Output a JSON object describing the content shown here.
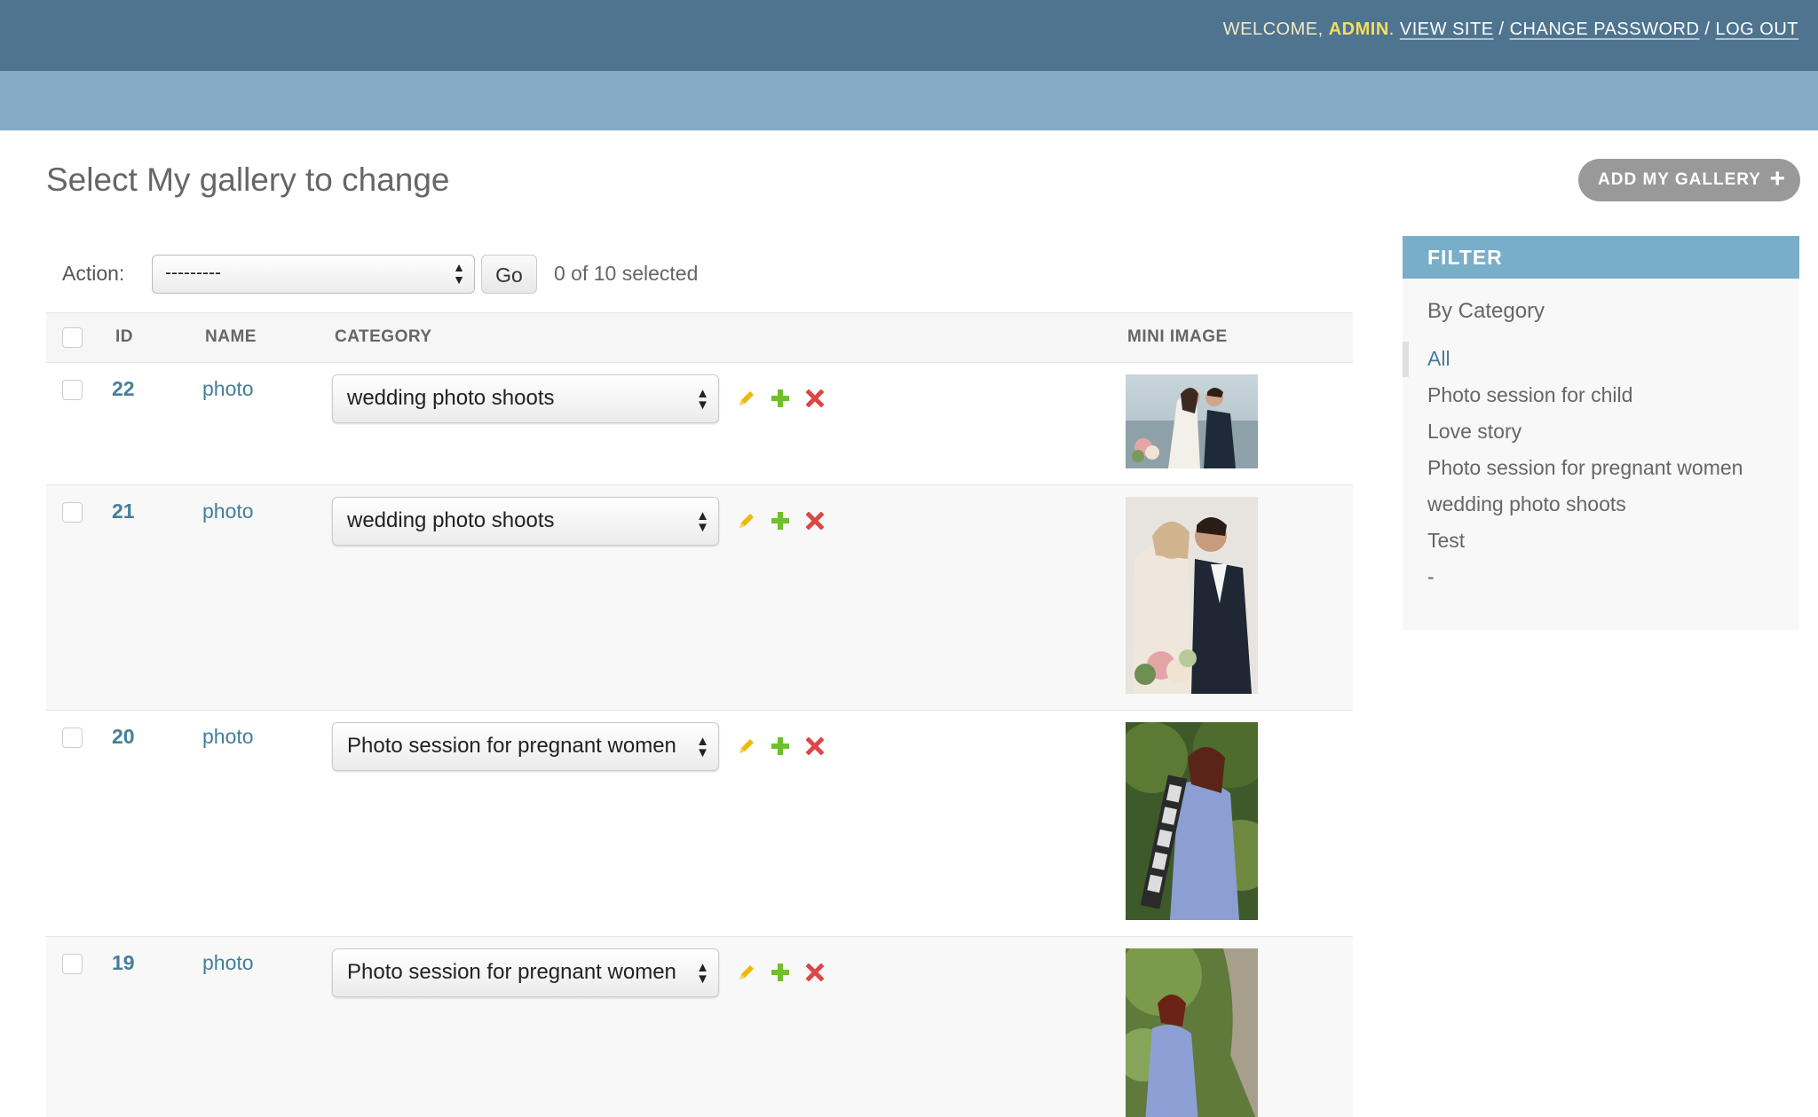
{
  "header": {
    "welcome": "WELCOME,",
    "user": "ADMIN",
    "dot": ".",
    "view_site": "VIEW SITE",
    "change_password": "CHANGE PASSWORD",
    "log_out": "LOG OUT",
    "sep": "/"
  },
  "page": {
    "title": "Select My gallery to change",
    "add_button": "ADD MY GALLERY",
    "add_icon": "+"
  },
  "actions": {
    "label": "Action:",
    "select_value": "---------",
    "go": "Go",
    "selected_count": "0 of 10 selected"
  },
  "table": {
    "columns": [
      "ID",
      "NAME",
      "CATEGORY",
      "MINI IMAGE"
    ],
    "rows": [
      {
        "id": "22",
        "name": "photo",
        "category": "wedding photo shoots"
      },
      {
        "id": "21",
        "name": "photo",
        "category": "wedding photo shoots"
      },
      {
        "id": "20",
        "name": "photo",
        "category": "Photo session for pregnant women"
      },
      {
        "id": "19",
        "name": "photo",
        "category": "Photo session for pregnant women"
      }
    ]
  },
  "filter": {
    "title": "FILTER",
    "by": "By Category",
    "items": [
      "All",
      "Photo session for child",
      "Love story",
      "Photo session for pregnant women",
      "wedding photo shoots",
      "Test",
      "-"
    ]
  },
  "colors": {
    "header_bg": "#4e7490",
    "breadcrumb_bg": "#86abc6",
    "link": "#447e9b",
    "filter_head": "#79aec8",
    "edit_icon": "#efb80b",
    "add_icon": "#70bf2b",
    "delete_icon": "#dd4646"
  },
  "icons": [
    "pencil-icon",
    "plus-icon",
    "delete-x-icon",
    "select-arrows-icon"
  ]
}
